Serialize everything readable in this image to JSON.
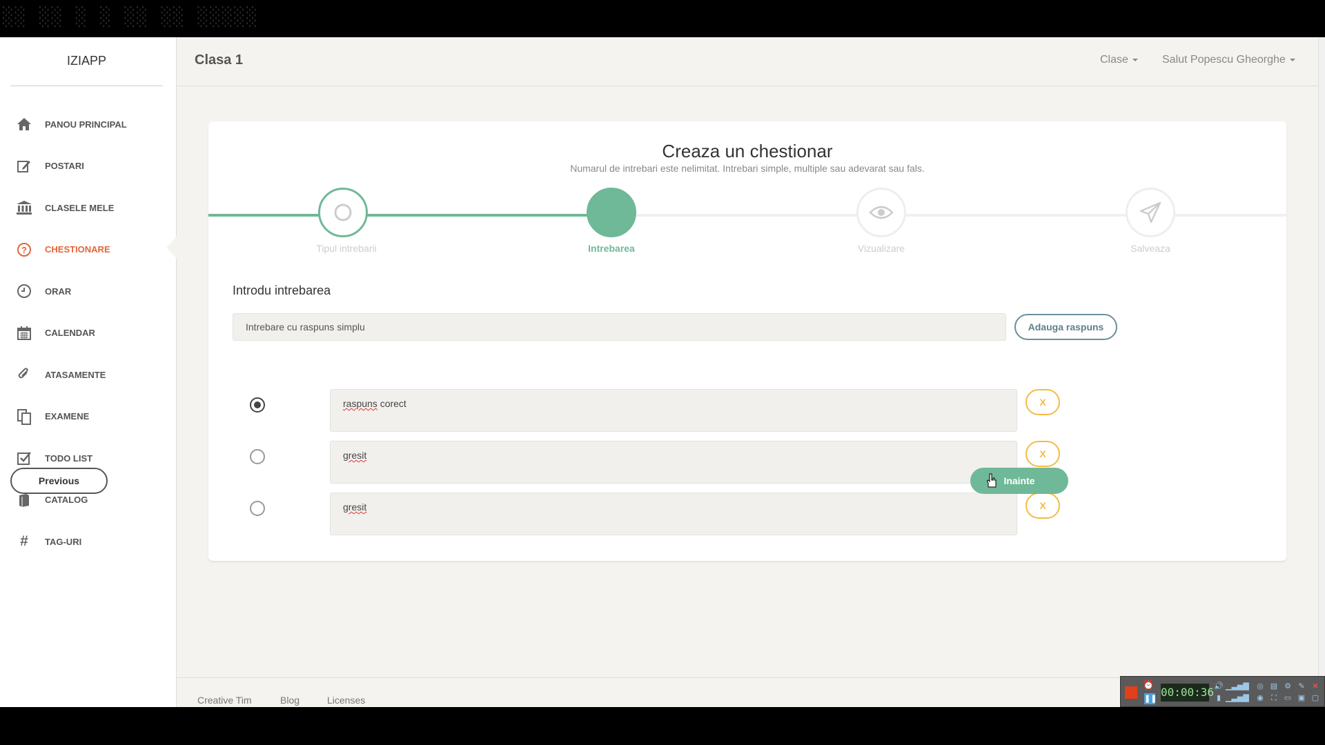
{
  "window": {
    "garbled_title": "░░ ░░ ░ ░ ░░ ░░ ░░░░░"
  },
  "sidebar": {
    "logo": "IZIAPP",
    "items": [
      {
        "label": "PANOU PRINCIPAL",
        "icon": "home-icon"
      },
      {
        "label": "POSTARI",
        "icon": "edit-icon"
      },
      {
        "label": "CLASELE MELE",
        "icon": "bank-icon"
      },
      {
        "label": "CHESTIONARE",
        "icon": "question-icon",
        "active": true
      },
      {
        "label": "ORAR",
        "icon": "clock-icon"
      },
      {
        "label": "CALENDAR",
        "icon": "calendar-icon"
      },
      {
        "label": "ATASAMENTE",
        "icon": "paperclip-icon"
      },
      {
        "label": "EXAMENE",
        "icon": "files-icon"
      },
      {
        "label": "TODO LIST",
        "icon": "checkbox-icon"
      },
      {
        "label": "CATALOG",
        "icon": "book-icon"
      },
      {
        "label": "TAG-URI",
        "icon": "hashtag-icon"
      }
    ]
  },
  "header": {
    "title": "Clasa 1",
    "classes_menu": "Clase",
    "user_menu": "Salut Popescu Gheorghe"
  },
  "wizard": {
    "title": "Creaza un chestionar",
    "subtitle": "Numarul de intrebari este nelimitat. Intrebari simple, multiple sau adevarat sau fals.",
    "steps": [
      {
        "label": "Tipul intrebarii",
        "state": "done"
      },
      {
        "label": "Intrebarea",
        "state": "current"
      },
      {
        "label": "Vizualizare",
        "state": "pending"
      },
      {
        "label": "Salveaza",
        "state": "pending"
      }
    ],
    "section_label": "Introdu intrebarea",
    "question_value": "Intrebare cu raspuns simplu",
    "add_answer_label": "Adauga raspuns",
    "answers": [
      {
        "text_word1": "raspuns",
        "text_rest": " corect",
        "selected": true,
        "remove_label": "X"
      },
      {
        "text_word1": "gresit",
        "text_rest": "",
        "selected": false,
        "remove_label": "X"
      },
      {
        "text_word1": "gresit",
        "text_rest": "",
        "selected": false,
        "remove_label": "X"
      }
    ],
    "previous_label": "Previous",
    "next_label": "Inainte"
  },
  "footer": {
    "links": [
      "Creative Tim",
      "Blog",
      "Licenses"
    ]
  },
  "recorder": {
    "time": "00:00:36"
  },
  "colors": {
    "accent": "#6fb898",
    "active_nav": "#e0663c",
    "warning": "#f3bb45"
  }
}
